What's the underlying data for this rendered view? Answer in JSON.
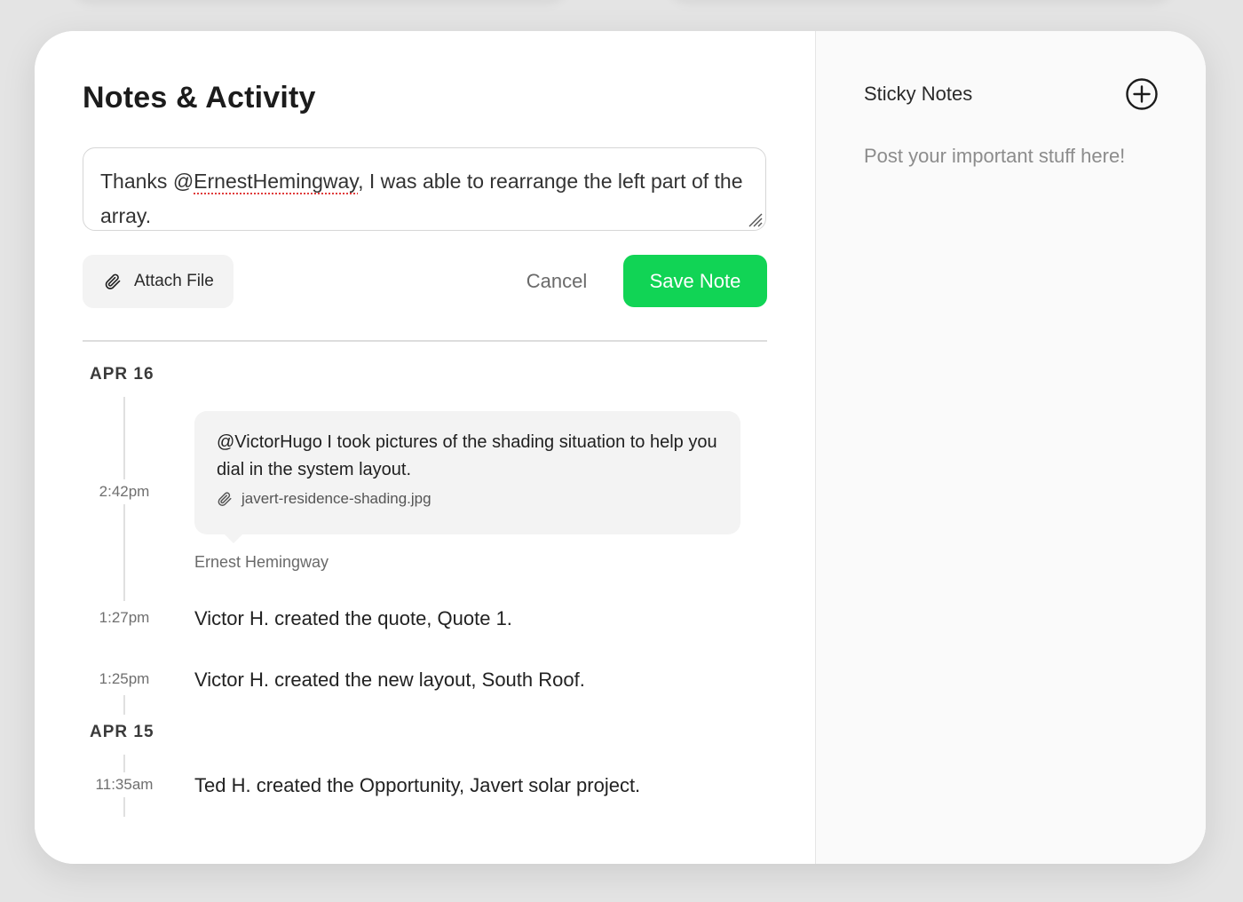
{
  "notes": {
    "title": "Notes & Activity",
    "draft": {
      "before_mention": "Thanks @",
      "mention": "ErnestHemingway",
      "after_mention": ", I was able to rearrange the left part of the array."
    },
    "attach_label": "Attach File",
    "cancel_label": "Cancel",
    "save_label": "Save Note"
  },
  "timeline": {
    "groups": [
      {
        "date": "APR 16",
        "entries": [
          {
            "time": "2:42pm",
            "text": "@VictorHugo I took pictures of the shading situation to help you dial in the system layout.",
            "attachment": "javert-residence-shading.jpg",
            "author": "Ernest Hemingway"
          },
          {
            "time": "1:27pm",
            "text": "Victor H. created the quote, Quote 1."
          },
          {
            "time": "1:25pm",
            "text": "Victor H. created the new layout, South Roof."
          }
        ]
      },
      {
        "date": "APR 15",
        "entries": [
          {
            "time": "11:35am",
            "text": "Ted H. created the Opportunity, Javert solar project."
          }
        ]
      }
    ]
  },
  "sticky": {
    "title": "Sticky Notes",
    "empty_text": "Post your important stuff here!"
  },
  "colors": {
    "accent": "#11d455",
    "panel": "#fafafa",
    "bubble": "#f3f3f3"
  },
  "icons": {
    "attach": "paperclip-icon",
    "add": "plus-circle-icon"
  }
}
